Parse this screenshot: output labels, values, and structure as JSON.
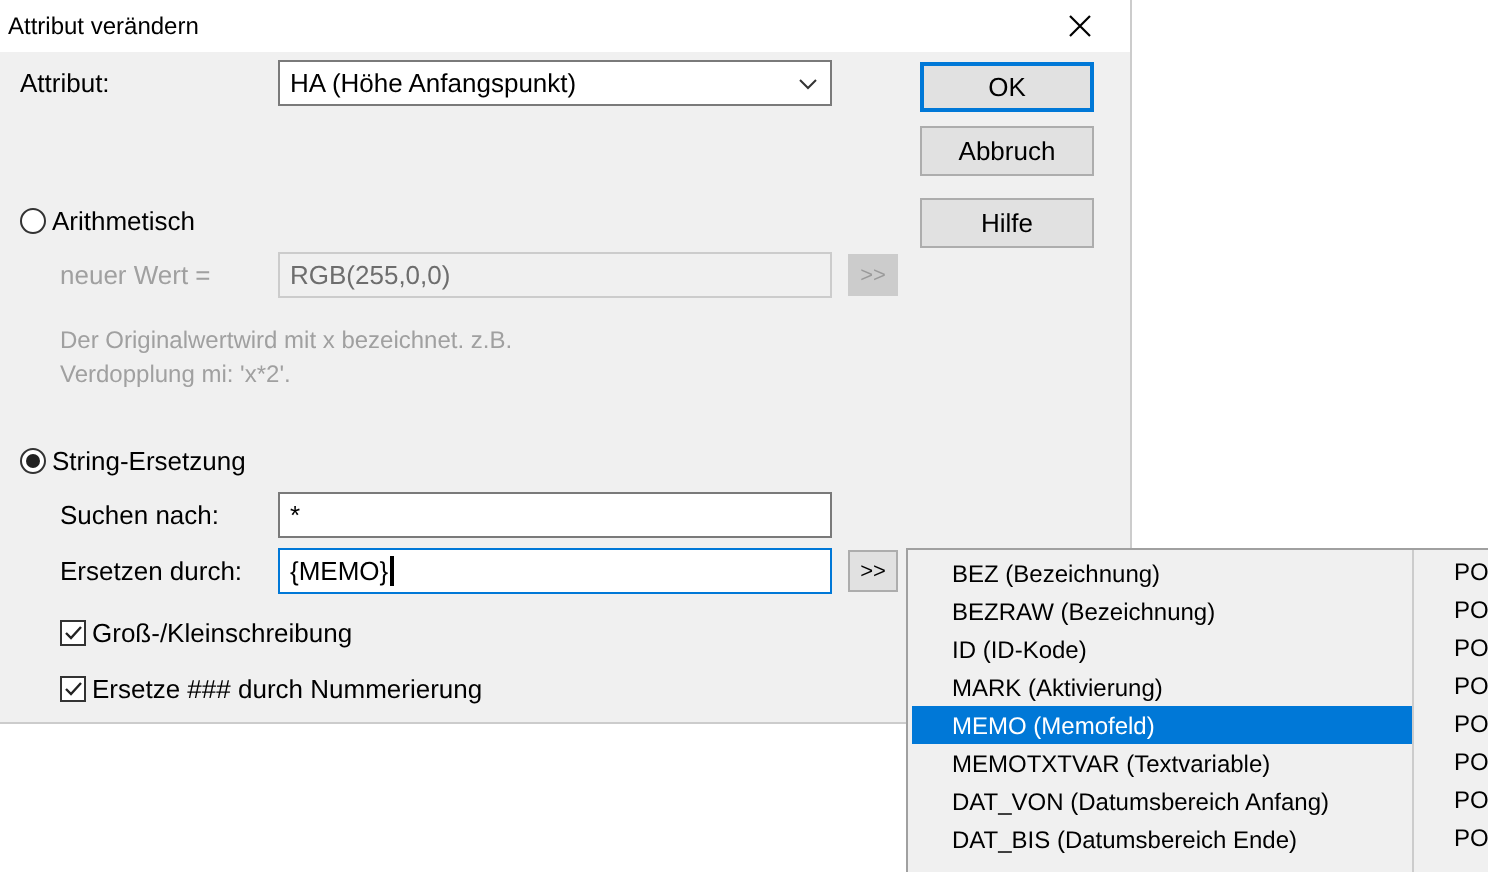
{
  "window": {
    "title": "Attribut verändern"
  },
  "attribute": {
    "label": "Attribut:",
    "value": "HA (Höhe Anfangspunkt)"
  },
  "buttons": [
    {
      "label": "OK",
      "default": true
    },
    {
      "label": "Abbruch",
      "default": false
    },
    {
      "label": "Hilfe",
      "default": false
    }
  ],
  "arithmetic": {
    "label": "Arithmetisch",
    "selected": false,
    "disabled": true,
    "value_label": "neuer Wert =",
    "value": "RGB(255,0,0)",
    "insert_button": ">>",
    "hint_lines": [
      "Der Originalwertwird mit x bezeichnet. z.B.",
      "Verdopplung mi: 'x*2'."
    ]
  },
  "string_replace": {
    "label": "String-Ersetzung",
    "selected": true,
    "search_label": "Suchen nach:",
    "search_value": "*",
    "replace_label": "Ersetzen durch:",
    "replace_value": "{MEMO}",
    "insert_button": ">>",
    "options": [
      {
        "label": "Groß-/Kleinschreibung",
        "checked": true
      },
      {
        "label": "Ersetze ### durch Nummerierung",
        "checked": true
      }
    ]
  },
  "menu": {
    "items": [
      {
        "label": "BEZ (Bezeichnung)",
        "column_2": "PO",
        "selected": false
      },
      {
        "label": "BEZRAW (Bezeichnung)",
        "column_2": "PO",
        "selected": false
      },
      {
        "label": "ID (ID-Kode)",
        "column_2": "PO",
        "selected": false
      },
      {
        "label": "MARK (Aktivierung)",
        "column_2": "PO",
        "selected": false
      },
      {
        "label": "MEMO (Memofeld)",
        "column_2": "PO",
        "selected": true
      },
      {
        "label": "MEMOTXTVAR (Textvariable)",
        "column_2": "PO",
        "selected": false
      },
      {
        "label": "DAT_VON (Datumsbereich Anfang)",
        "column_2": "PO",
        "selected": false
      },
      {
        "label": "DAT_BIS (Datumsbereich Ende)",
        "column_2": "PO",
        "selected": false
      }
    ]
  }
}
